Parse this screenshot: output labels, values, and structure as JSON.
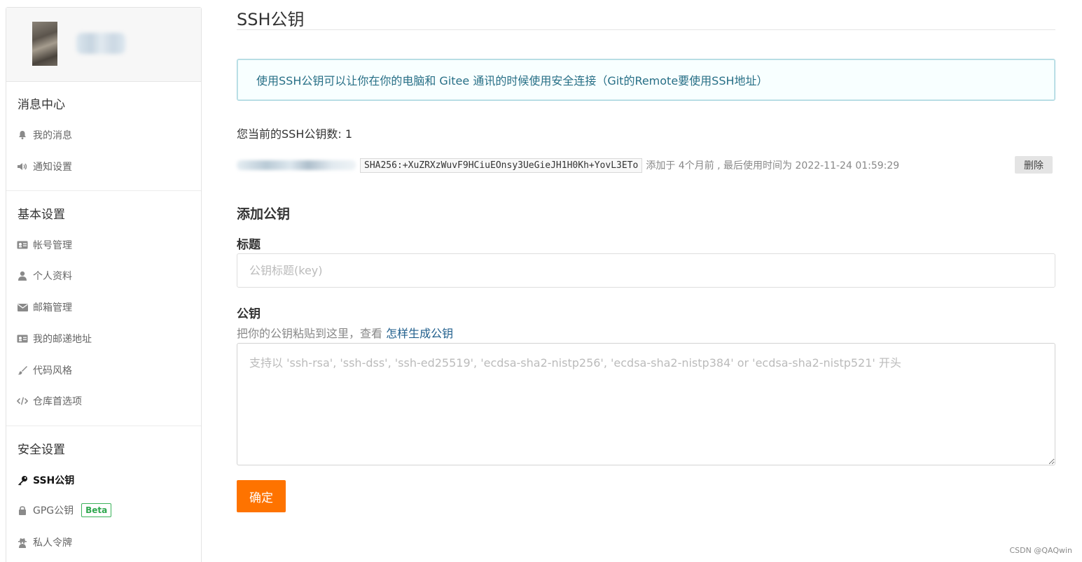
{
  "sidebar": {
    "groups": [
      {
        "title": "消息中心",
        "items": [
          {
            "label": "我的消息",
            "icon": "bell-icon"
          },
          {
            "label": "通知设置",
            "icon": "speaker-icon"
          }
        ]
      },
      {
        "title": "基本设置",
        "items": [
          {
            "label": "帐号管理",
            "icon": "id-card-icon"
          },
          {
            "label": "个人资料",
            "icon": "user-icon"
          },
          {
            "label": "邮箱管理",
            "icon": "envelope-icon"
          },
          {
            "label": "我的邮递地址",
            "icon": "address-card-icon"
          },
          {
            "label": "代码风格",
            "icon": "paintbrush-icon"
          },
          {
            "label": "仓库首选项",
            "icon": "code-icon"
          }
        ]
      },
      {
        "title": "安全设置",
        "items": [
          {
            "label": "SSH公钥",
            "icon": "key-icon",
            "active": true
          },
          {
            "label": "GPG公钥",
            "icon": "lock-icon",
            "badge": "Beta"
          },
          {
            "label": "私人令牌",
            "icon": "spy-icon"
          }
        ]
      }
    ]
  },
  "main": {
    "title": "SSH公钥",
    "info": "使用SSH公钥可以让你在你的电脑和 Gitee 通讯的时候使用安全连接（Git的Remote要使用SSH地址）",
    "count_line": "您当前的SSH公钥数: 1",
    "key": {
      "fingerprint": "SHA256:+XuZRXzWuvF9HCiuEOnsy3UeGieJH1H0Kh+YovL3ETo",
      "meta": "添加于 4个月前 , 最后使用时间为 2022-11-24 01:59:29",
      "delete_label": "删除"
    },
    "add_heading": "添加公钥",
    "title_label": "标题",
    "title_placeholder": "公钥标题(key)",
    "key_label": "公钥",
    "helper_prefix": "把你的公钥粘贴到这里，查看 ",
    "helper_link": "怎样生成公钥",
    "key_placeholder": "支持以 'ssh-rsa', 'ssh-dss', 'ssh-ed25519', 'ecdsa-sha2-nistp256', 'ecdsa-sha2-nistp384' or 'ecdsa-sha2-nistp521' 开头",
    "submit_label": "确定"
  },
  "watermark": "CSDN @QAQwin",
  "colors": {
    "accent_orange": "#fe7300",
    "info_text": "#276f86",
    "info_border": "#a9d5de",
    "beta_green": "#2fa84f",
    "link_blue": "#1f5e8c"
  }
}
